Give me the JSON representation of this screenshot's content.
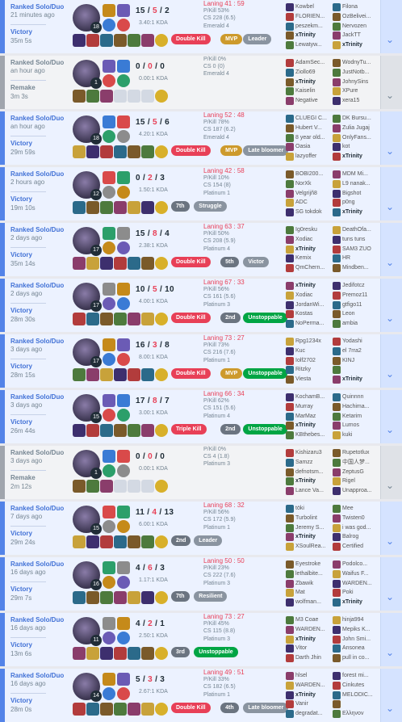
{
  "matches": [
    {
      "queue": "Ranked Solo/Duo",
      "ago": "21 minutes ago",
      "result": "Victory",
      "duration": "35m 5s",
      "outcome": "win",
      "champion_level": "18",
      "kills": "15",
      "deaths": "5",
      "assists": "2",
      "kda_ratio": "3.40:1 KDA",
      "laning": "Laning 41 : 59",
      "pkill": "P/Kill 53%",
      "cs": "CS 228 (6.5)",
      "rank": "Emerald 4",
      "badges": [
        {
          "label": "Double Kill",
          "color": "red"
        },
        {
          "label": "MVP",
          "color": "gold"
        },
        {
          "label": "Leader",
          "color": "gray"
        }
      ],
      "team1": [
        "Kowbel",
        "FLORIEN...",
        "peszekm...",
        "xTrinity",
        "Lewatyw..."
      ],
      "team2": [
        "Filona",
        "OzBelivei...",
        "Nervozen",
        "JackTT",
        "xTrinity"
      ],
      "me": "xTrinity"
    },
    {
      "queue": "Ranked Solo/Duo",
      "ago": "an hour ago",
      "result": "Remake",
      "duration": "3m 3s",
      "outcome": "remake",
      "champion_level": "1",
      "kills": "0",
      "deaths": "0",
      "assists": "0",
      "kda_ratio": "0.00:1 KDA",
      "laning": "",
      "pkill": "P/Kill 0%",
      "cs": "CS 0 (0)",
      "rank": "Emerald 4",
      "badges": [],
      "team1": [
        "AdamSec...",
        "Ziollo69",
        "xTrinity",
        "Kaiselin",
        "Negative"
      ],
      "team2": [
        "WodnyTu...",
        "JustNotb...",
        "JohnySins",
        "XPure",
        "xera15"
      ],
      "me": "xTrinity"
    },
    {
      "queue": "Ranked Solo/Duo",
      "ago": "an hour ago",
      "result": "Victory",
      "duration": "29m 59s",
      "outcome": "win",
      "champion_level": "18",
      "kills": "15",
      "deaths": "5",
      "assists": "6",
      "kda_ratio": "4.20:1 KDA",
      "laning": "Laning 52 : 48",
      "pkill": "P/Kill 78%",
      "cs": "CS 187 (6.2)",
      "rank": "Emerald 4",
      "badges": [
        {
          "label": "Double Kill",
          "color": "red"
        },
        {
          "label": "MVP",
          "color": "gold"
        },
        {
          "label": "Late bloomer",
          "color": "gray"
        }
      ],
      "team1": [
        "CLUEGI C...",
        "Hubert V...",
        "8 year old...",
        "Oasia",
        "lazyoffer"
      ],
      "team2": [
        "DK Bursu...",
        "Zulia Jugaj",
        "OnlyFans...",
        "kot",
        "xTrinity"
      ],
      "me": "xTrinity"
    },
    {
      "queue": "Ranked Solo/Duo",
      "ago": "2 hours ago",
      "result": "Victory",
      "duration": "19m 10s",
      "outcome": "win",
      "champion_level": "12",
      "kills": "0",
      "deaths": "2",
      "assists": "3",
      "kda_ratio": "1.50:1 KDA",
      "laning": "Laning 42 : 58",
      "pkill": "P/Kill 10%",
      "cs": "CS 154 (8)",
      "rank": "Platinum 1",
      "badges": [
        {
          "label": "7th",
          "color": "dg"
        },
        {
          "label": "Struggle",
          "color": "gray"
        }
      ],
      "team1": [
        "BOBI200...",
        "NorXk",
        "Velgrijñ8",
        "ADC",
        "SG tokdok"
      ],
      "team2": [
        "MDM Mi...",
        "L9 nanak...",
        "Bigshot",
        "p0ng",
        "xTrinity"
      ],
      "me": "xTrinity"
    },
    {
      "queue": "Ranked Solo/Duo",
      "ago": "2 days ago",
      "result": "Victory",
      "duration": "35m 14s",
      "outcome": "win",
      "champion_level": "17",
      "kills": "15",
      "deaths": "8",
      "assists": "4",
      "kda_ratio": "2.38:1 KDA",
      "laning": "Laning 63 : 37",
      "pkill": "P/Kill 50%",
      "cs": "CS 208 (5.9)",
      "rank": "Platinum 4",
      "badges": [
        {
          "label": "Double Kill",
          "color": "red"
        },
        {
          "label": "5th",
          "color": "dg"
        },
        {
          "label": "Victor",
          "color": "gray"
        }
      ],
      "team1": [
        "Ig0resku",
        "Xodiac",
        "xTrinity",
        "Kemix",
        "QmChern..."
      ],
      "team2": [
        "DeathOfa...",
        "tuns tuns",
        "SAM3 ZUO",
        "HR",
        "Mindben..."
      ],
      "me": "xTrinity"
    },
    {
      "queue": "Ranked Solo/Duo",
      "ago": "2 days ago",
      "result": "Victory",
      "duration": "28m 30s",
      "outcome": "win",
      "champion_level": "17",
      "kills": "10",
      "deaths": "5",
      "assists": "10",
      "kda_ratio": "4.00:1 KDA",
      "laning": "Laning 67 : 33",
      "pkill": "P/Kill 56%",
      "cs": "CS 161 (5.6)",
      "rank": "Platinum 3",
      "badges": [
        {
          "label": "Double Kill",
          "color": "red"
        },
        {
          "label": "2nd",
          "color": "dg"
        },
        {
          "label": "Unstoppable",
          "color": "green"
        }
      ],
      "team1": [
        "xTrinity",
        "Xodiac",
        "JordanWi...",
        "Kostas",
        "NoPerma..."
      ],
      "team2": [
        "Jedifotcz",
        "Premoz11",
        "gtfigo11",
        "Leon",
        "ambia"
      ],
      "me": "xTrinity"
    },
    {
      "queue": "Ranked Solo/Duo",
      "ago": "3 days ago",
      "result": "Victory",
      "duration": "28m 15s",
      "outcome": "win",
      "champion_level": "17",
      "kills": "16",
      "deaths": "3",
      "assists": "8",
      "kda_ratio": "8.00:1 KDA",
      "laning": "Laning 73 : 27",
      "pkill": "P/Kill 73%",
      "cs": "CS 216 (7.6)",
      "rank": "Platinum 1",
      "badges": [
        {
          "label": "Double Kill",
          "color": "red"
        },
        {
          "label": "MVP",
          "color": "gold"
        },
        {
          "label": "Unstoppable",
          "color": "green"
        }
      ],
      "team1": [
        "Rpg1234x",
        "Kuc",
        "Iolf2702",
        "Ritzky",
        "Viesta"
      ],
      "team2": [
        "Yodashi",
        "el 7rra2",
        "KINJ",
        "",
        "xTrinity"
      ],
      "me": "xTrinity"
    },
    {
      "queue": "Ranked Solo/Duo",
      "ago": "3 days ago",
      "result": "Victory",
      "duration": "26m 44s",
      "outcome": "win",
      "champion_level": "15",
      "kills": "17",
      "deaths": "8",
      "assists": "7",
      "kda_ratio": "3.00:1 KDA",
      "laning": "Laning 66 : 34",
      "pkill": "P/Kill 62%",
      "cs": "CS 151 (5.6)",
      "rank": "Platinum 4",
      "badges": [
        {
          "label": "Triple Kill",
          "color": "red"
        },
        {
          "label": "2nd",
          "color": "dg"
        },
        {
          "label": "Unstoppable",
          "color": "green"
        }
      ],
      "team1": [
        "KochamB...",
        "Murray",
        "MarMaz",
        "xTrinity",
        "KBthebes..."
      ],
      "team2": [
        "Quinnnn",
        "Hachima...",
        "Ketarim",
        "Lumos",
        "kuki"
      ],
      "me": "xTrinity"
    },
    {
      "queue": "Ranked Solo/Duo",
      "ago": "3 days ago",
      "result": "Remake",
      "duration": "2m 12s",
      "outcome": "remake",
      "champion_level": "1",
      "kills": "0",
      "deaths": "0",
      "assists": "0",
      "kda_ratio": "0.00:1 KDA",
      "laning": "",
      "pkill": "P/Kill 0%",
      "cs": "CS 4 (1.8)",
      "rank": "Platinum 3",
      "badges": [],
      "team1": [
        "Kishizaru3",
        "Samzz",
        "defnotsm...",
        "xTrinity",
        "Lance Va..."
      ],
      "team2": [
        "Rupetotlux",
        "中国人梦...",
        "ZeptusG",
        "Rigel",
        "Unapproa..."
      ],
      "me": "xTrinity"
    },
    {
      "queue": "Ranked Solo/Duo",
      "ago": "7 days ago",
      "result": "Victory",
      "duration": "29m 24s",
      "outcome": "win",
      "champion_level": "15",
      "kills": "11",
      "deaths": "4",
      "assists": "13",
      "kda_ratio": "6.00:1 KDA",
      "laning": "Laning 68 : 32",
      "pkill": "P/Kill 56%",
      "cs": "CS 172 (5.9)",
      "rank": "Platinum 1",
      "badges": [
        {
          "label": "2nd",
          "color": "dg"
        },
        {
          "label": "Leader",
          "color": "gray"
        }
      ],
      "team1": [
        "töki",
        "Turbolint",
        "Jeremy S...",
        "xTrinity",
        "XSoulRea..."
      ],
      "team2": [
        "Mee",
        "Twisten0",
        "i was god...",
        "Balrog",
        "Certified"
      ],
      "me": "xTrinity"
    },
    {
      "queue": "Ranked Solo/Duo",
      "ago": "16 days ago",
      "result": "Victory",
      "duration": "29m 7s",
      "outcome": "win",
      "champion_level": "16",
      "kills": "4",
      "deaths": "6",
      "assists": "3",
      "kda_ratio": "1.17:1 KDA",
      "laning": "Laning 50 : 50",
      "pkill": "P/Kill 23%",
      "cs": "CS 222 (7.6)",
      "rank": "Platinum 3",
      "badges": [
        {
          "label": "7th",
          "color": "dg"
        },
        {
          "label": "Resilient",
          "color": "gray"
        }
      ],
      "team1": [
        "Eyestroke",
        "lethalbite...",
        "Zbawik",
        "Mat",
        "wolfman..."
      ],
      "team2": [
        "Podolco...",
        "Waifus F...",
        "WARDEN...",
        "Poki",
        "xTrinity"
      ],
      "me": "xTrinity"
    },
    {
      "queue": "Ranked Solo/Duo",
      "ago": "16 days ago",
      "result": "Victory",
      "duration": "13m 6s",
      "outcome": "win",
      "champion_level": "11",
      "kills": "4",
      "deaths": "2",
      "assists": "1",
      "kda_ratio": "2.50:1 KDA",
      "laning": "Laning 73 : 27",
      "pkill": "P/Kill 45%",
      "cs": "CS 115 (8.8)",
      "rank": "Platinum 3",
      "badges": [
        {
          "label": "3rd",
          "color": "dg"
        },
        {
          "label": "Unstoppable",
          "color": "green"
        }
      ],
      "team1": [
        "M3 Coae",
        "WARDEN...",
        "xTrinity",
        "Vitor",
        "Darth Jhin"
      ],
      "team2": [
        "hinja994",
        "Mepiks K...",
        "John Smi...",
        "Ansonea",
        "pull in co..."
      ],
      "me": "xTrinity"
    },
    {
      "queue": "Ranked Solo/Duo",
      "ago": "16 days ago",
      "result": "Victory",
      "duration": "28m 0s",
      "outcome": "win",
      "champion_level": "14",
      "kills": "5",
      "deaths": "3",
      "assists": "3",
      "kda_ratio": "2.67:1 KDA",
      "laning": "Laning 49 : 51",
      "pkill": "P/Kill 33%",
      "cs": "CS 182 (6.5)",
      "rank": "Platinum 1",
      "badges": [
        {
          "label": "Double Kill",
          "color": "red"
        },
        {
          "label": "4th",
          "color": "dg"
        },
        {
          "label": "Late bloomer",
          "color": "gray"
        }
      ],
      "team1": [
        "hlsel",
        "WARDEN...",
        "xTrinity",
        "Vanir",
        "degradat..."
      ],
      "team2": [
        "forest mi...",
        "Cinkutes",
        "MELODIC...",
        "",
        "Ελληνov"
      ],
      "me": "xTrinity"
    }
  ],
  "colors": {
    "win": "#5383e8",
    "loss": "#e84057",
    "remake": "#a0a5ad"
  }
}
